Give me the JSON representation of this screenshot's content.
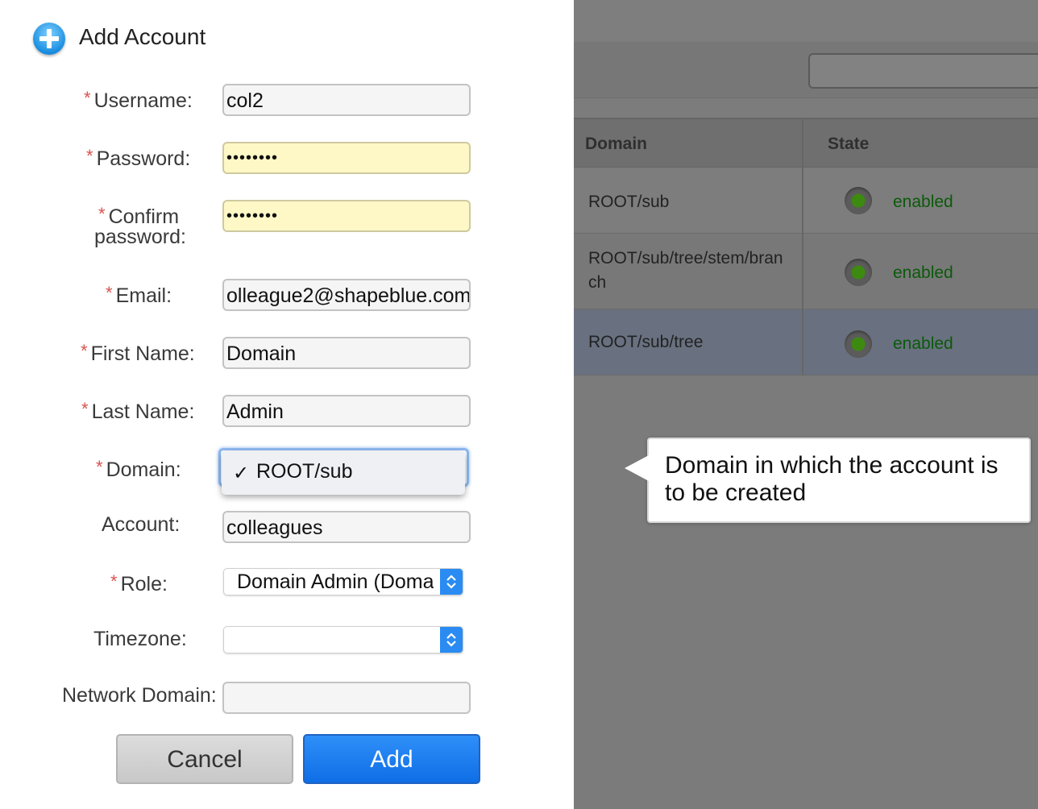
{
  "dialog": {
    "title": "Add Account",
    "fields": {
      "username": {
        "label": "Username:",
        "value": "col2",
        "required": true
      },
      "password": {
        "label": "Password:",
        "value": "••••••••",
        "required": true
      },
      "confirm_password": {
        "label_line1": "Confirm",
        "label_line2": "password:",
        "value": "••••••••",
        "required": true
      },
      "email": {
        "label": "Email:",
        "value": "olleague2@shapeblue.com",
        "required": true
      },
      "first_name": {
        "label": "First Name:",
        "value": "Domain",
        "required": true
      },
      "last_name": {
        "label": "Last Name:",
        "value": "Admin",
        "required": true
      },
      "domain": {
        "label": "Domain:",
        "selected": "ROOT/sub",
        "check": "✓",
        "required": true
      },
      "account": {
        "label": "Account:",
        "value": "colleagues"
      },
      "role": {
        "label": "Role:",
        "selected": "Domain Admin (Domain Admin)",
        "required": true
      },
      "timezone": {
        "label": "Timezone:",
        "selected": ""
      },
      "network_domain": {
        "label": "Network Domain:",
        "value": ""
      }
    },
    "required_marker": "*",
    "buttons": {
      "cancel": "Cancel",
      "add": "Add"
    }
  },
  "background": {
    "columns": {
      "domain": "Domain",
      "state": "State"
    },
    "rows": [
      {
        "domain": "ROOT/sub",
        "state": "enabled"
      },
      {
        "domain": "ROOT/sub/tree/stem/branch",
        "state": "enabled"
      },
      {
        "domain": "ROOT/sub/tree",
        "state": "enabled"
      }
    ]
  },
  "tooltip": {
    "text": "Domain in which the account is to be created"
  },
  "colors": {
    "primary_button": "#1479ec",
    "required": "#d9534f",
    "state_enabled": "#0b5a0b",
    "autofill_bg": "#fdf8c6"
  }
}
